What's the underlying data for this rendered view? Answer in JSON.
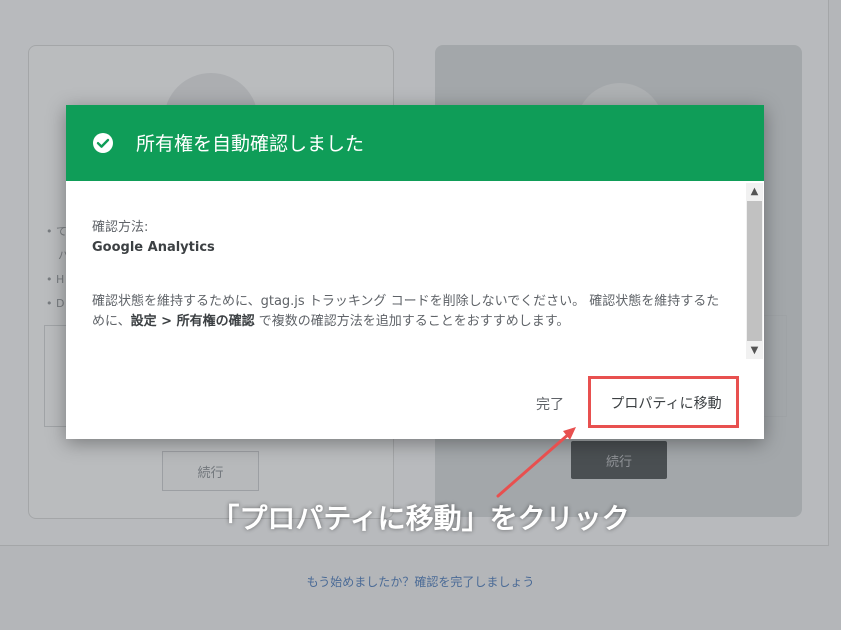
{
  "background": {
    "continue_label": "続行",
    "footer_link": "もう始めましたか？確認を完了しましょう",
    "bullets": [
      "• て",
      "ハ",
      "• H",
      "• D"
    ]
  },
  "dialog": {
    "title": "所有権を自動確認しました",
    "method_label": "確認方法:",
    "method_value": "Google Analytics",
    "description_part1": "確認状態を維持するために、gtag.js トラッキング コードを削除しないでください。 確認状態を維持するために、",
    "description_bold": "設定 > 所有権の確認",
    "description_part2": " で複数の確認方法を追加することをおすすめします。",
    "done_label": "完了",
    "goto_label": "プロパティに移動"
  },
  "annotation": {
    "callout_text": "「プロパティに移動」をクリック",
    "color": "#e8504f"
  },
  "colors": {
    "header_green": "#0f9d58",
    "link_blue": "#3c6fb7"
  },
  "icons": {
    "check": "check-circle-icon",
    "scroll_up": "chevron-up-icon",
    "scroll_down": "chevron-down-icon"
  }
}
